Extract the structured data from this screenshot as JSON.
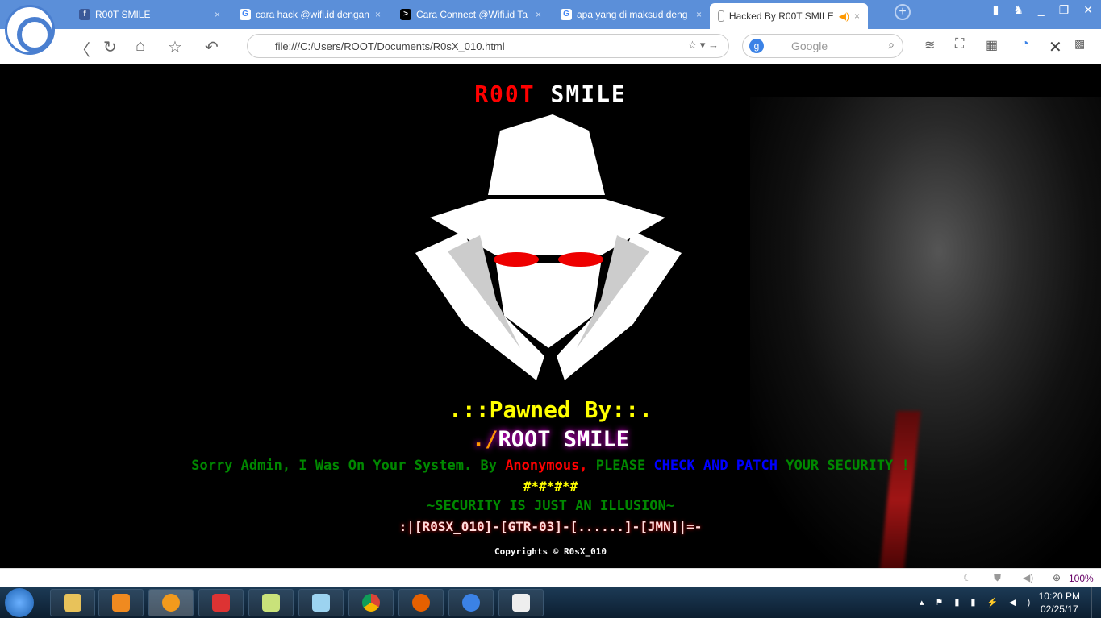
{
  "browser": {
    "tabs": [
      {
        "label": "R00T SMILE",
        "icon": "facebook-icon"
      },
      {
        "label": "cara hack @wifi.id dengan",
        "icon": "google-icon"
      },
      {
        "label": "Cara Connect @Wifi.id Ta",
        "icon": "terminal-icon"
      },
      {
        "label": "apa yang di maksud deng",
        "icon": "google-icon"
      },
      {
        "label": "Hacked By R00T SMILE",
        "icon": "page-icon",
        "active": true
      }
    ],
    "address": "file:///C:/Users/ROOT/Documents/R0sX_010.html",
    "search_placeholder": "Google",
    "zoom": "100%"
  },
  "page": {
    "title_red": "R00T",
    "title_white": "SMILE",
    "pawned": ".::Pawned By::.",
    "rs_prefix": "./",
    "rs_name": "ROOT SMILE",
    "sorry_1": "Sorry Admin, I Was On Your System. By ",
    "sorry_anon": "Anonymous,",
    "sorry_2": " PLEASE ",
    "sorry_blue": "CHECK AND PATCH",
    "sorry_3": " YOUR SECURITY !",
    "stars": "#*#*#*#",
    "illusion": "~SECURITY IS JUST AN ILLUSION~",
    "code": ":|[R0SX_010]-[GTR-03]-[......]-[JMN]|=-",
    "copyright": "Copyrights © R0sX_010"
  },
  "taskbar": {
    "time": "10:20 PM",
    "date": "02/25/17"
  },
  "colors": {
    "tabbar": "#5b8fd9",
    "red": "#ff0000",
    "yellow": "#ffff00",
    "green": "#008000",
    "blue": "#0000ff"
  }
}
